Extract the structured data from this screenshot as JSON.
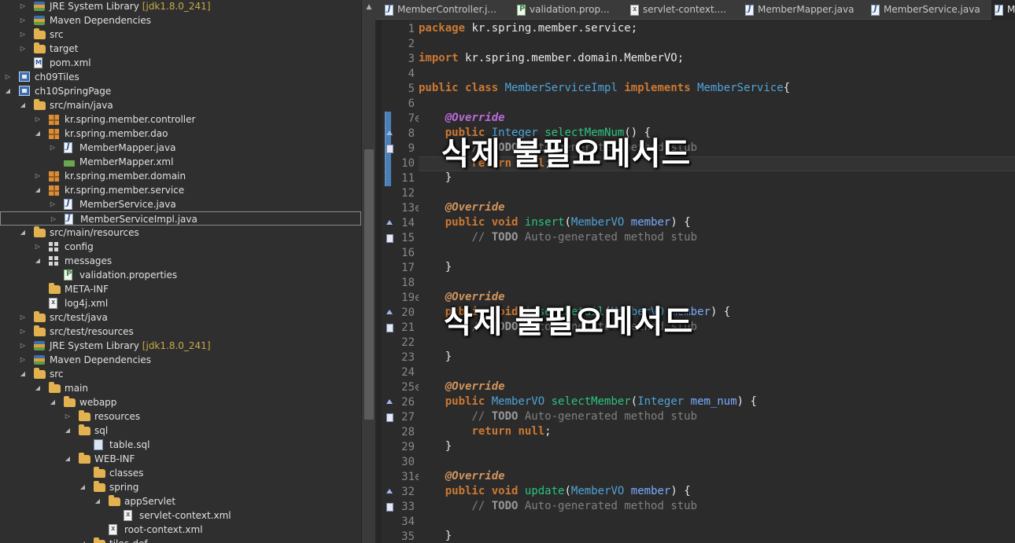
{
  "explorer": {
    "rows": [
      {
        "label": "JRE System Library",
        "deco": "[jdk1.8.0_241]",
        "icon": "library-icon",
        "arrow": "collapsed",
        "indent": 2
      },
      {
        "label": "Maven Dependencies",
        "icon": "library-icon",
        "arrow": "collapsed",
        "indent": 2
      },
      {
        "label": "src",
        "icon": "folder-icon",
        "arrow": "collapsed",
        "indent": 2
      },
      {
        "label": "target",
        "icon": "folder-icon",
        "arrow": "collapsed",
        "indent": 2
      },
      {
        "label": "pom.xml",
        "icon": "pom-icon",
        "arrow": "",
        "indent": 2
      },
      {
        "label": "ch09Tiles",
        "icon": "project-icon",
        "arrow": "collapsed",
        "indent": 1
      },
      {
        "label": "ch10SpringPage",
        "icon": "project-icon",
        "arrow": "expanded",
        "indent": 1
      },
      {
        "label": "src/main/java",
        "icon": "source-folder-icon",
        "arrow": "expanded",
        "indent": 2
      },
      {
        "label": "kr.spring.member.controller",
        "icon": "package-icon",
        "arrow": "collapsed",
        "indent": 3
      },
      {
        "label": "kr.spring.member.dao",
        "icon": "package-icon",
        "arrow": "expanded",
        "indent": 3
      },
      {
        "label": "MemberMapper.java",
        "icon": "java-file-icon",
        "arrow": "collapsed",
        "indent": 4
      },
      {
        "label": "MemberMapper.xml",
        "icon": "mapper-xml-icon",
        "arrow": "",
        "indent": 4
      },
      {
        "label": "kr.spring.member.domain",
        "icon": "package-icon",
        "arrow": "collapsed",
        "indent": 3
      },
      {
        "label": "kr.spring.member.service",
        "icon": "package-icon",
        "arrow": "expanded",
        "indent": 3
      },
      {
        "label": "MemberService.java",
        "icon": "java-file-icon",
        "arrow": "collapsed",
        "indent": 4
      },
      {
        "label": "MemberServiceImpl.java",
        "icon": "java-file-icon",
        "arrow": "collapsed",
        "indent": 4,
        "selected": true
      },
      {
        "label": "src/main/resources",
        "icon": "source-folder-icon",
        "arrow": "expanded",
        "indent": 2
      },
      {
        "label": "config",
        "icon": "package-white-icon",
        "arrow": "collapsed",
        "indent": 3
      },
      {
        "label": "messages",
        "icon": "package-white-icon",
        "arrow": "expanded",
        "indent": 3
      },
      {
        "label": "validation.properties",
        "icon": "properties-icon",
        "arrow": "",
        "indent": 4
      },
      {
        "label": "META-INF",
        "icon": "folder-icon",
        "arrow": "",
        "indent": 3
      },
      {
        "label": "log4j.xml",
        "icon": "xml-file-icon",
        "arrow": "",
        "indent": 3
      },
      {
        "label": "src/test/java",
        "icon": "source-folder-icon",
        "arrow": "collapsed",
        "indent": 2
      },
      {
        "label": "src/test/resources",
        "icon": "source-folder-icon",
        "arrow": "collapsed",
        "indent": 2
      },
      {
        "label": "JRE System Library",
        "deco": "[jdk1.8.0_241]",
        "icon": "library-icon",
        "arrow": "collapsed",
        "indent": 2
      },
      {
        "label": "Maven Dependencies",
        "icon": "library-icon",
        "arrow": "collapsed",
        "indent": 2
      },
      {
        "label": "src",
        "icon": "folder-icon",
        "arrow": "expanded",
        "indent": 2
      },
      {
        "label": "main",
        "icon": "folder-icon",
        "arrow": "expanded",
        "indent": 3
      },
      {
        "label": "webapp",
        "icon": "folder-icon",
        "arrow": "expanded",
        "indent": 4
      },
      {
        "label": "resources",
        "icon": "folder-icon",
        "arrow": "collapsed",
        "indent": 5
      },
      {
        "label": "sql",
        "icon": "folder-icon",
        "arrow": "expanded",
        "indent": 5
      },
      {
        "label": "table.sql",
        "icon": "sql-file-icon",
        "arrow": "",
        "indent": 6
      },
      {
        "label": "WEB-INF",
        "icon": "folder-icon",
        "arrow": "expanded",
        "indent": 5
      },
      {
        "label": "classes",
        "icon": "folder-icon",
        "arrow": "",
        "indent": 6
      },
      {
        "label": "spring",
        "icon": "folder-icon",
        "arrow": "expanded",
        "indent": 6
      },
      {
        "label": "appServlet",
        "icon": "folder-icon",
        "arrow": "expanded",
        "indent": 7
      },
      {
        "label": "servlet-context.xml",
        "icon": "xml-file-icon",
        "arrow": "",
        "indent": 8
      },
      {
        "label": "root-context.xml",
        "icon": "xml-file-icon",
        "arrow": "",
        "indent": 7
      },
      {
        "label": "tiles-def",
        "icon": "folder-icon",
        "arrow": "expanded",
        "indent": 6
      }
    ]
  },
  "editor": {
    "tabs": [
      {
        "label": "MemberController.j...",
        "icon": "java-file-icon"
      },
      {
        "label": "validation.prop...",
        "icon": "properties-icon"
      },
      {
        "label": "servlet-context....",
        "icon": "xml-file-icon"
      },
      {
        "label": "MemberMapper.java",
        "icon": "java-file-icon"
      },
      {
        "label": "MemberService.java",
        "icon": "java-file-icon"
      },
      {
        "label": "M",
        "icon": "java-file-icon",
        "active": true
      }
    ],
    "lines": [
      {
        "n": "1",
        "tokens": [
          [
            "kw",
            "package"
          ],
          [
            "plain",
            " kr.spring.member.service;"
          ]
        ]
      },
      {
        "n": "2",
        "tokens": []
      },
      {
        "n": "3",
        "tokens": [
          [
            "kw",
            "import"
          ],
          [
            "plain",
            " kr.spring.member.domain.MemberVO;"
          ]
        ]
      },
      {
        "n": "4",
        "tokens": []
      },
      {
        "n": "5",
        "tokens": [
          [
            "kw",
            "public"
          ],
          [
            "plain",
            " "
          ],
          [
            "kw",
            "class"
          ],
          [
            "plain",
            " "
          ],
          [
            "type",
            "MemberServiceImpl"
          ],
          [
            "plain",
            " "
          ],
          [
            "kw",
            "implements"
          ],
          [
            "plain",
            " "
          ],
          [
            "type",
            "MemberService"
          ],
          [
            "plain",
            "{"
          ]
        ]
      },
      {
        "n": "6",
        "tokens": []
      },
      {
        "n": "7",
        "fold": true,
        "marker": true,
        "tokens": [
          [
            "plain",
            "    "
          ],
          [
            "ann",
            "@Override"
          ]
        ]
      },
      {
        "n": "8",
        "override": true,
        "marker": true,
        "tokens": [
          [
            "plain",
            "    "
          ],
          [
            "kw",
            "public"
          ],
          [
            "plain",
            " "
          ],
          [
            "type",
            "Integer"
          ],
          [
            "plain",
            " "
          ],
          [
            "meth",
            "selectMemNum"
          ],
          [
            "plain",
            "() {"
          ]
        ]
      },
      {
        "n": "9",
        "task": true,
        "marker": true,
        "tokens": [
          [
            "plain",
            "        "
          ],
          [
            "cmt",
            "// "
          ],
          [
            "todo",
            "TODO"
          ],
          [
            "cmt",
            " Auto-generated method stub"
          ]
        ]
      },
      {
        "n": "10",
        "marker": true,
        "current": true,
        "tokens": [
          [
            "plain",
            "        "
          ],
          [
            "kw",
            "return"
          ],
          [
            "plain",
            " "
          ],
          [
            "kw",
            "null"
          ],
          [
            "plain",
            ";"
          ]
        ]
      },
      {
        "n": "11",
        "marker": true,
        "tokens": [
          [
            "plain",
            "    }"
          ]
        ]
      },
      {
        "n": "12",
        "tokens": []
      },
      {
        "n": "13",
        "fold": true,
        "tokens": [
          [
            "plain",
            "    "
          ],
          [
            "ann2",
            "@Override"
          ]
        ]
      },
      {
        "n": "14",
        "override": true,
        "tokens": [
          [
            "plain",
            "    "
          ],
          [
            "kw",
            "public"
          ],
          [
            "plain",
            " "
          ],
          [
            "kw",
            "void"
          ],
          [
            "plain",
            " "
          ],
          [
            "meth",
            "insert"
          ],
          [
            "plain",
            "("
          ],
          [
            "type",
            "MemberVO"
          ],
          [
            "plain",
            " "
          ],
          [
            "param",
            "member"
          ],
          [
            "plain",
            ") {"
          ]
        ]
      },
      {
        "n": "15",
        "task": true,
        "tokens": [
          [
            "plain",
            "        "
          ],
          [
            "cmt",
            "// "
          ],
          [
            "todo",
            "TODO"
          ],
          [
            "cmt",
            " Auto-generated method stub"
          ]
        ]
      },
      {
        "n": "16",
        "tokens": []
      },
      {
        "n": "17",
        "tokens": [
          [
            "plain",
            "    }"
          ]
        ]
      },
      {
        "n": "18",
        "tokens": []
      },
      {
        "n": "19",
        "fold": true,
        "tokens": [
          [
            "plain",
            "    "
          ],
          [
            "ann2",
            "@Override"
          ]
        ]
      },
      {
        "n": "20",
        "override": true,
        "tokens": [
          [
            "plain",
            "    "
          ],
          [
            "kw",
            "public"
          ],
          [
            "plain",
            " "
          ],
          [
            "kw",
            "void"
          ],
          [
            "plain",
            " "
          ],
          [
            "meth",
            "insertDetail"
          ],
          [
            "plain",
            "("
          ],
          [
            "type",
            "MemberVO"
          ],
          [
            "plain",
            " "
          ],
          [
            "param",
            "member"
          ],
          [
            "plain",
            ") {"
          ]
        ]
      },
      {
        "n": "21",
        "task": true,
        "tokens": [
          [
            "plain",
            "        "
          ],
          [
            "cmt",
            "// "
          ],
          [
            "todo",
            "TODO"
          ],
          [
            "cmt",
            " Auto-generated method stub"
          ]
        ]
      },
      {
        "n": "22",
        "tokens": []
      },
      {
        "n": "23",
        "tokens": [
          [
            "plain",
            "    }"
          ]
        ]
      },
      {
        "n": "24",
        "tokens": []
      },
      {
        "n": "25",
        "fold": true,
        "tokens": [
          [
            "plain",
            "    "
          ],
          [
            "ann2",
            "@Override"
          ]
        ]
      },
      {
        "n": "26",
        "override": true,
        "tokens": [
          [
            "plain",
            "    "
          ],
          [
            "kw",
            "public"
          ],
          [
            "plain",
            " "
          ],
          [
            "type",
            "MemberVO"
          ],
          [
            "plain",
            " "
          ],
          [
            "meth",
            "selectMember"
          ],
          [
            "plain",
            "("
          ],
          [
            "type",
            "Integer"
          ],
          [
            "plain",
            " "
          ],
          [
            "param",
            "mem_num"
          ],
          [
            "plain",
            ") {"
          ]
        ]
      },
      {
        "n": "27",
        "task": true,
        "tokens": [
          [
            "plain",
            "        "
          ],
          [
            "cmt",
            "// "
          ],
          [
            "todo",
            "TODO"
          ],
          [
            "cmt",
            " Auto-generated method stub"
          ]
        ]
      },
      {
        "n": "28",
        "tokens": [
          [
            "plain",
            "        "
          ],
          [
            "kw",
            "return"
          ],
          [
            "plain",
            " "
          ],
          [
            "kw",
            "null"
          ],
          [
            "plain",
            ";"
          ]
        ]
      },
      {
        "n": "29",
        "tokens": [
          [
            "plain",
            "    }"
          ]
        ]
      },
      {
        "n": "30",
        "tokens": []
      },
      {
        "n": "31",
        "fold": true,
        "tokens": [
          [
            "plain",
            "    "
          ],
          [
            "ann2",
            "@Override"
          ]
        ]
      },
      {
        "n": "32",
        "override": true,
        "tokens": [
          [
            "plain",
            "    "
          ],
          [
            "kw",
            "public"
          ],
          [
            "plain",
            " "
          ],
          [
            "kw",
            "void"
          ],
          [
            "plain",
            " "
          ],
          [
            "meth",
            "update"
          ],
          [
            "plain",
            "("
          ],
          [
            "type",
            "MemberVO"
          ],
          [
            "plain",
            " "
          ],
          [
            "param",
            "member"
          ],
          [
            "plain",
            ") {"
          ]
        ]
      },
      {
        "n": "33",
        "task": true,
        "tokens": [
          [
            "plain",
            "        "
          ],
          [
            "cmt",
            "// "
          ],
          [
            "todo",
            "TODO"
          ],
          [
            "cmt",
            " Auto-generated method stub"
          ]
        ]
      },
      {
        "n": "34",
        "tokens": []
      },
      {
        "n": "35",
        "tokens": [
          [
            "plain",
            "    }"
          ]
        ]
      }
    ]
  },
  "overlays": {
    "note_1": "삭제 불필요메서드",
    "note_2": "삭제 불필요메서드"
  },
  "colors": {
    "keyword": "#cc7832",
    "annotation": "#bb6bd9",
    "type": "#4fa3d9",
    "method": "#2bc47e",
    "param": "#79abff",
    "comment": "#808080"
  }
}
